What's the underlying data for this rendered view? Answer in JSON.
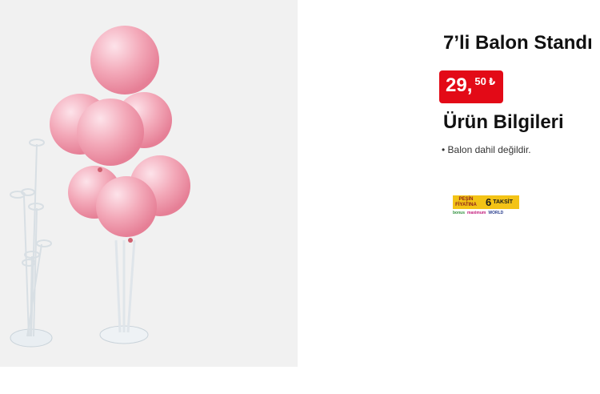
{
  "product": {
    "title": "7’li Balon Standı",
    "price": {
      "main": "29,",
      "fraction": "50",
      "currency": "₺"
    },
    "info_heading": "Ürün Bilgileri",
    "info_items": [
      "Balon dahil değildir."
    ]
  },
  "installment_badge": {
    "pesin_line1": "PEŞİN",
    "pesin_line2": "FİYATINA",
    "count": "6",
    "word": "TAKSİT",
    "brands": [
      "bonus",
      "maximum",
      "WORLD"
    ]
  },
  "colors": {
    "price_red": "#e30a17",
    "badge_yellow": "#f3c316",
    "balloon_pink": "#f2a7b6"
  }
}
